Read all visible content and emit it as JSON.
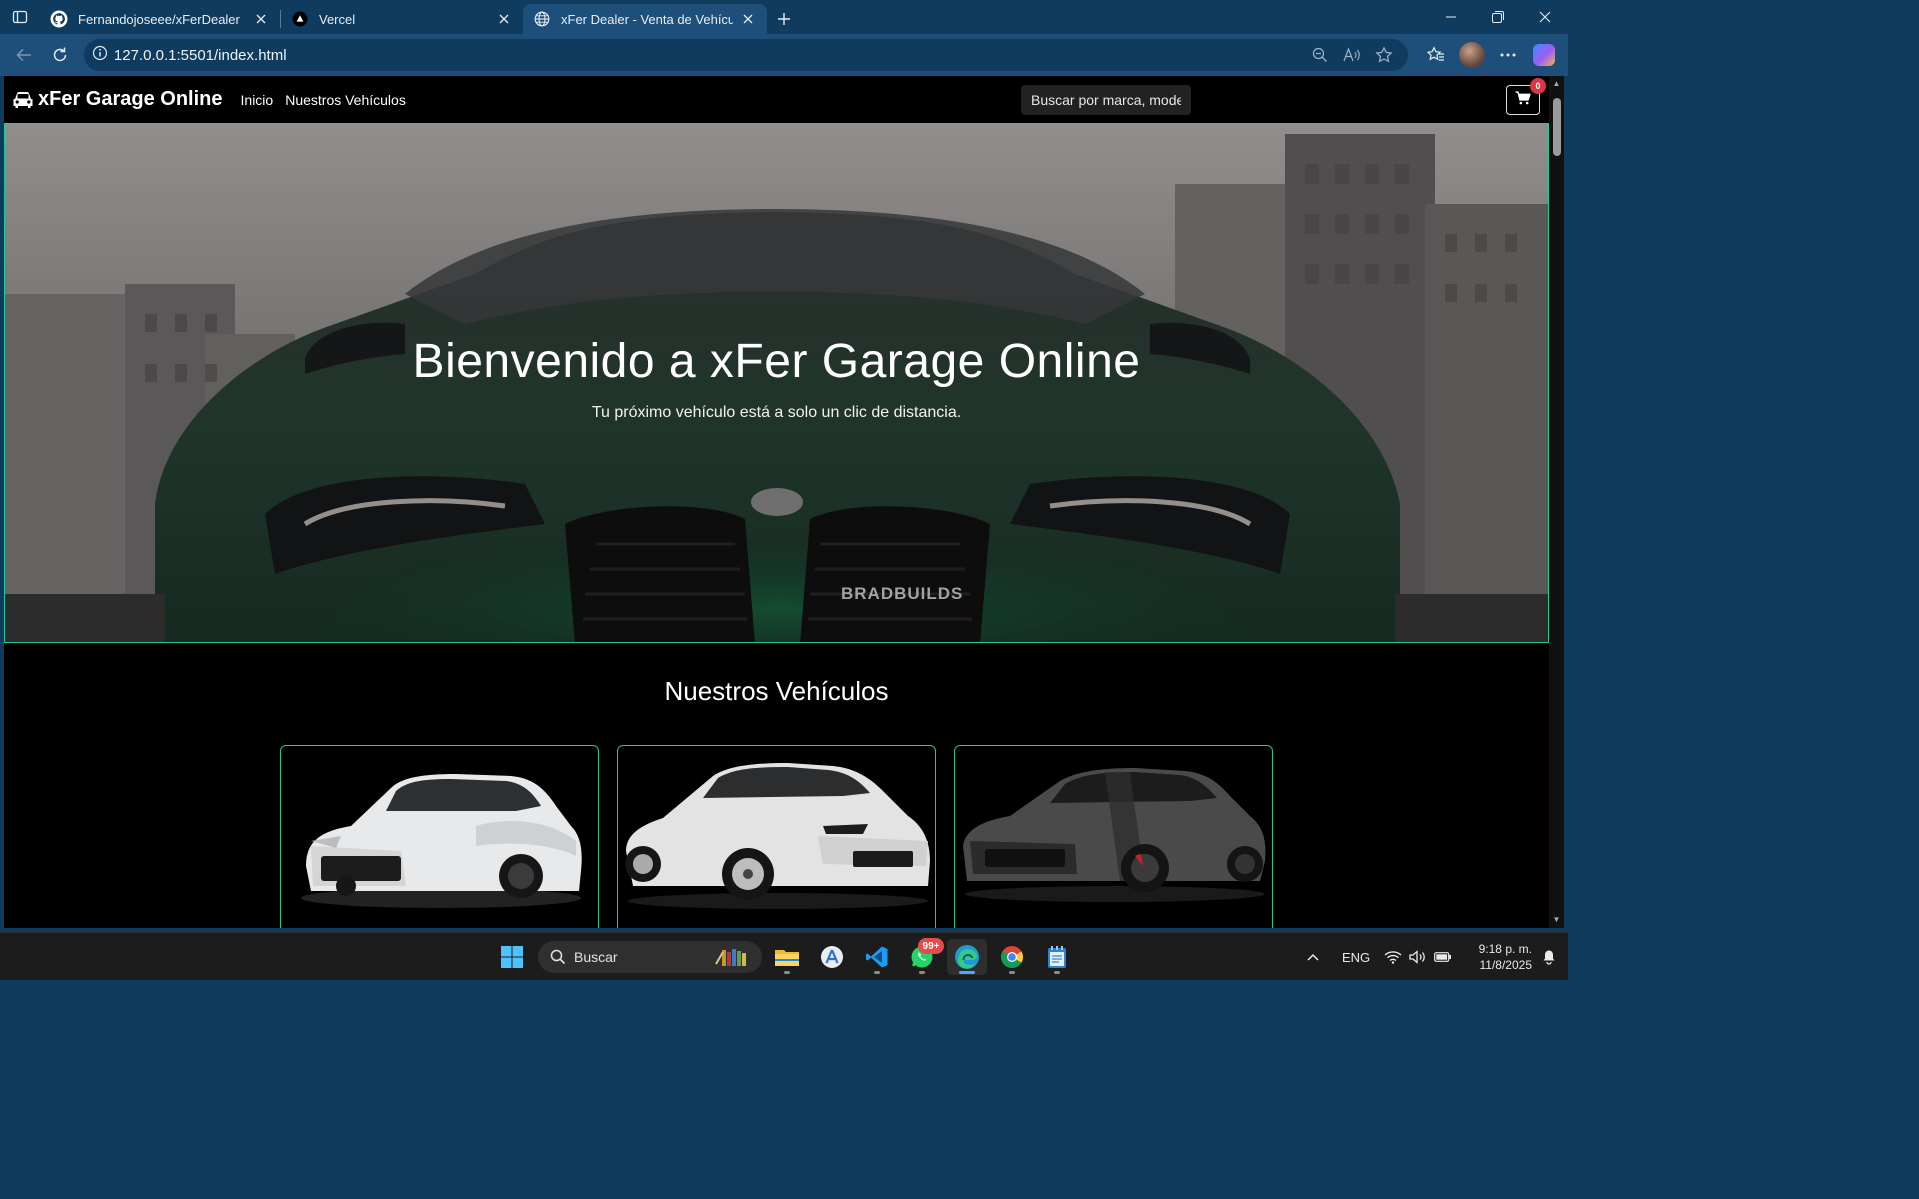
{
  "browser": {
    "tabs": [
      {
        "title": "Fernandojoseee/xFerDealer",
        "icon": "github-icon",
        "active": false
      },
      {
        "title": "Vercel",
        "icon": "vercel-icon",
        "active": false
      },
      {
        "title": "xFer Dealer - Venta de Vehículos I",
        "icon": "globe-icon",
        "active": true
      }
    ],
    "url": "127.0.0.1:5501/index.html"
  },
  "site": {
    "brand": "xFer Garage Online",
    "nav": [
      "Inicio",
      "Nuestros Vehículos"
    ],
    "search_placeholder": "Buscar por marca, modelo",
    "cart_count": "0",
    "hero": {
      "title": "Bienvenido a xFer Garage Online",
      "subtitle": "Tu próximo vehículo está a solo un clic de distancia.",
      "watermark": "BRADBUILDS"
    },
    "section_title": "Nuestros Vehículos",
    "cards": [
      {
        "image": "white-hatchback",
        "color": "#e8e9eb"
      },
      {
        "image": "white-sedan",
        "color": "#e3e3e3"
      },
      {
        "image": "dark-gray-muscle-car",
        "color": "#4a4a4a"
      }
    ],
    "accent": "#20c997"
  },
  "taskbar": {
    "search": "Buscar",
    "whatsapp_badge": "99+",
    "language": "ENG",
    "time": "9:18 p. m.",
    "date": "11/8/2025"
  }
}
